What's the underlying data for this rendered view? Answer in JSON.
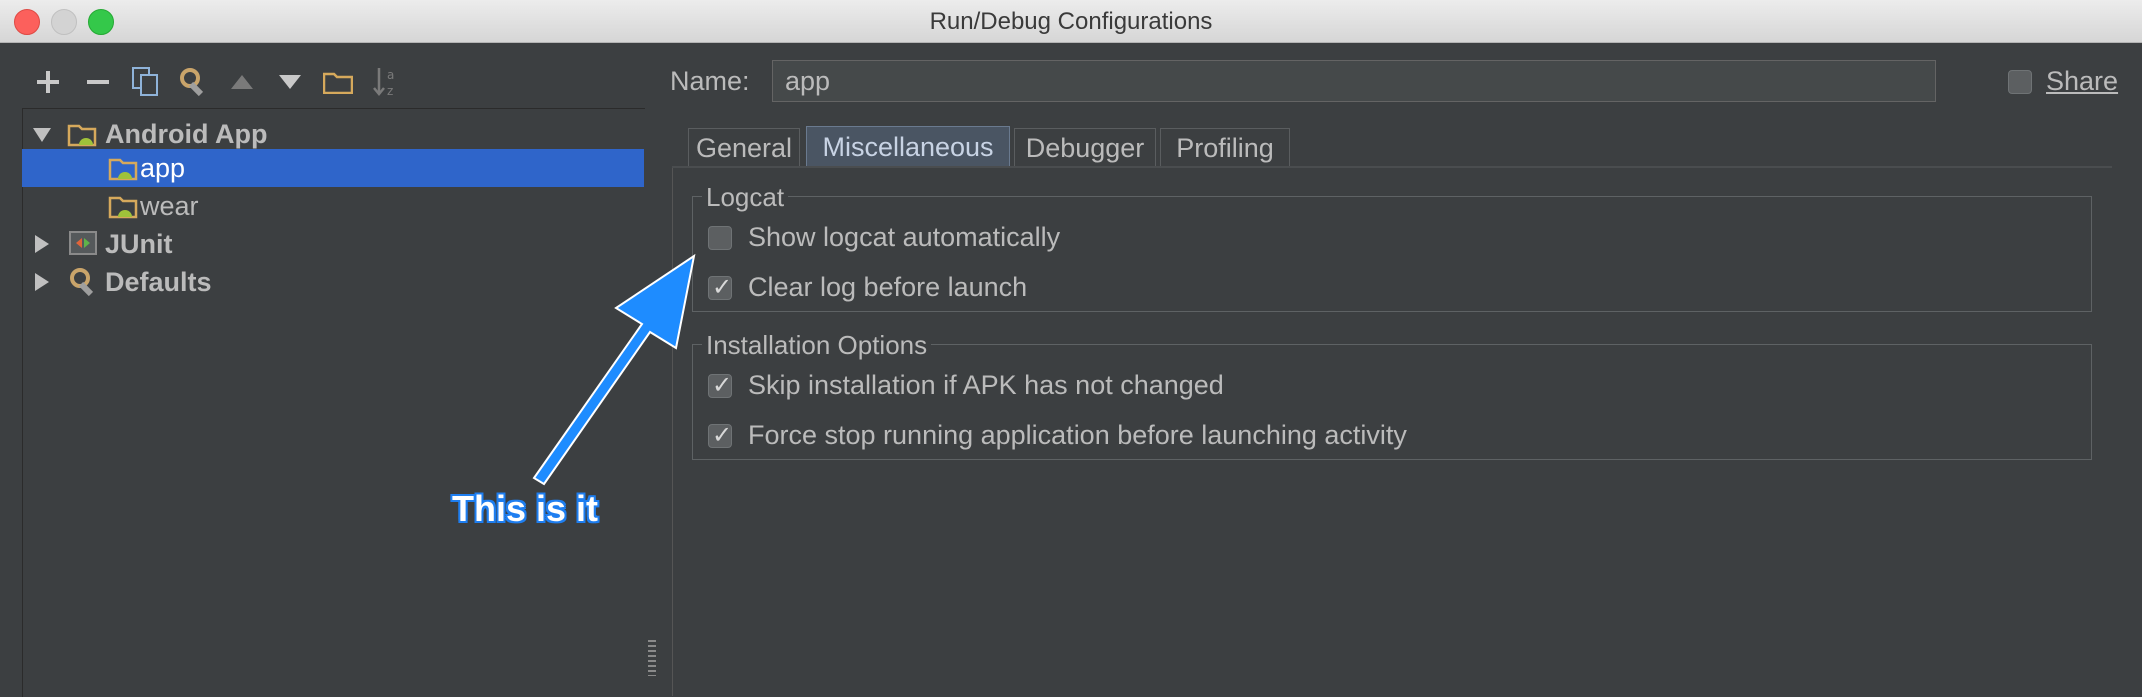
{
  "window": {
    "title": "Run/Debug Configurations"
  },
  "toolbar": {
    "buttons": [
      "add-icon",
      "remove-icon",
      "copy-icon",
      "edit-defaults-icon",
      "move-up-icon",
      "move-down-icon",
      "folder-icon",
      "sort-icon"
    ]
  },
  "tree": {
    "items": [
      {
        "label": "Android App",
        "expanded": true,
        "icon": "android-folder-icon"
      },
      {
        "label": "app",
        "selected": true,
        "icon": "android-module-icon"
      },
      {
        "label": "wear",
        "icon": "android-module-icon"
      },
      {
        "label": "JUnit",
        "expanded": false,
        "icon": "junit-icon"
      },
      {
        "label": "Defaults",
        "expanded": false,
        "icon": "wrench-icon"
      }
    ]
  },
  "config": {
    "name_label": "Name:",
    "name_value": "app",
    "share_label": "Share",
    "share_checked": false
  },
  "tabs": [
    {
      "label": "General"
    },
    {
      "label": "Miscellaneous",
      "active": true
    },
    {
      "label": "Debugger"
    },
    {
      "label": "Profiling"
    }
  ],
  "logcat": {
    "title": "Logcat",
    "options": [
      {
        "label": "Show logcat automatically",
        "checked": false
      },
      {
        "label": "Clear log before launch",
        "checked": true
      }
    ]
  },
  "installation": {
    "title": "Installation Options",
    "options": [
      {
        "label": "Skip installation if APK has not changed",
        "checked": true
      },
      {
        "label": "Force stop running application before launching activity",
        "checked": true
      }
    ]
  },
  "annotation": {
    "text": "This is it",
    "color": "#1e7ef0"
  },
  "colors": {
    "background": "#3c3f41",
    "selection": "#2f65ca",
    "text": "#bbbbbb"
  }
}
